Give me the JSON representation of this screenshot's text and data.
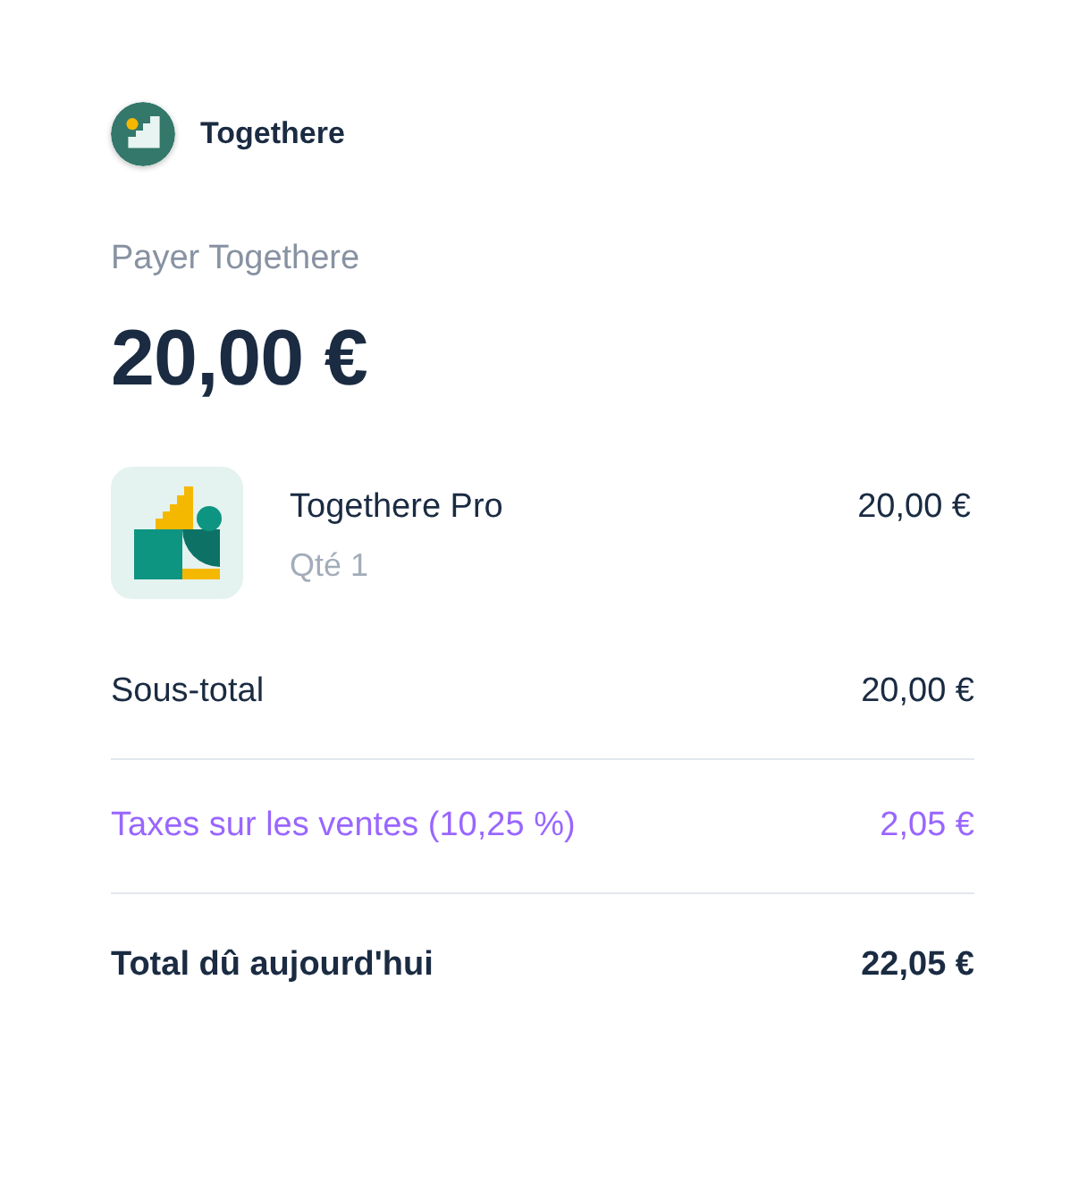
{
  "merchant": {
    "name": "Togethere"
  },
  "payment": {
    "label": "Payer Togethere",
    "amount": "20,00 €"
  },
  "line_items": [
    {
      "name": "Togethere Pro",
      "quantity": "Qté 1",
      "price": "20,00 €"
    }
  ],
  "summary": [
    {
      "kind": "subtotal",
      "label": "Sous-total",
      "amount": "20,00 €"
    },
    {
      "kind": "tax",
      "label": "Taxes sur les ventes (10,25 %)",
      "amount": "2,05 €"
    },
    {
      "kind": "total",
      "label": "Total dû aujourd'hui",
      "amount": "22,05 €"
    }
  ]
}
